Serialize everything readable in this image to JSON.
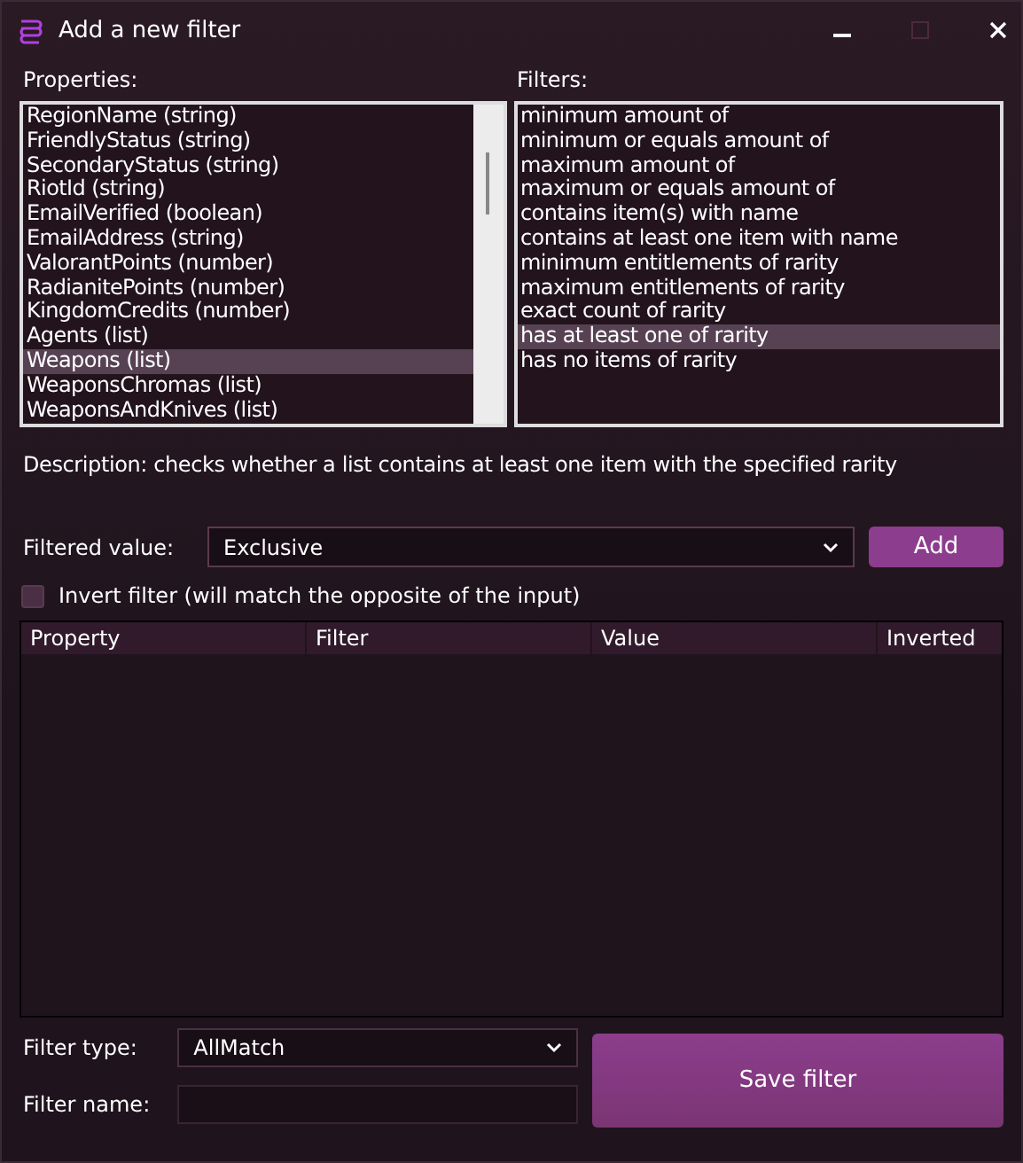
{
  "window": {
    "title": "Add a new filter",
    "maximize_disabled": true
  },
  "properties": {
    "label": "Properties:",
    "items": [
      {
        "label": "RegionName (string)",
        "selected": false
      },
      {
        "label": "FriendlyStatus (string)",
        "selected": false
      },
      {
        "label": "SecondaryStatus (string)",
        "selected": false
      },
      {
        "label": "RiotId (string)",
        "selected": false
      },
      {
        "label": "EmailVerified (boolean)",
        "selected": false
      },
      {
        "label": "EmailAddress (string)",
        "selected": false
      },
      {
        "label": "ValorantPoints (number)",
        "selected": false
      },
      {
        "label": "RadianitePoints (number)",
        "selected": false
      },
      {
        "label": "KingdomCredits (number)",
        "selected": false
      },
      {
        "label": "Agents (list)",
        "selected": false
      },
      {
        "label": "Weapons (list)",
        "selected": true
      },
      {
        "label": "WeaponsChromas (list)",
        "selected": false
      },
      {
        "label": "WeaponsAndKnives (list)",
        "selected": false
      }
    ]
  },
  "filters": {
    "label": "Filters:",
    "items": [
      {
        "label": "minimum amount of",
        "selected": false
      },
      {
        "label": "minimum or equals amount of",
        "selected": false
      },
      {
        "label": "maximum amount of",
        "selected": false
      },
      {
        "label": "maximum or equals amount of",
        "selected": false
      },
      {
        "label": "contains item(s) with name",
        "selected": false
      },
      {
        "label": "contains at least one item with name",
        "selected": false
      },
      {
        "label": "minimum entitlements of rarity",
        "selected": false
      },
      {
        "label": "maximum entitlements of rarity",
        "selected": false
      },
      {
        "label": "exact count of rarity",
        "selected": false
      },
      {
        "label": "has at least one of rarity",
        "selected": true
      },
      {
        "label": "has no items of rarity",
        "selected": false
      }
    ]
  },
  "description": "Description: checks whether a list contains at least one item with the specified rarity",
  "filtered_value": {
    "label": "Filtered value:",
    "value": "Exclusive"
  },
  "add_button": "Add",
  "invert": {
    "label": "Invert filter (will match the opposite of the input)",
    "checked": false
  },
  "table": {
    "columns": [
      "Property",
      "Filter",
      "Value",
      "Inverted"
    ]
  },
  "filter_type": {
    "label": "Filter type:",
    "value": "AllMatch"
  },
  "filter_name": {
    "label": "Filter name:"
  },
  "save_button": "Save filter"
}
